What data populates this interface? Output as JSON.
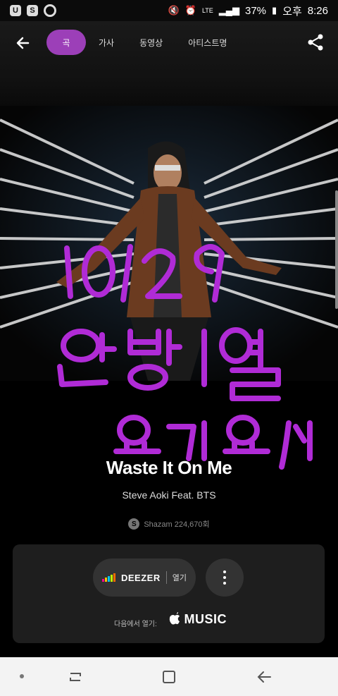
{
  "status_bar": {
    "battery": "37%",
    "network": "LTE",
    "ampm": "오후",
    "time": "8:26"
  },
  "app_bar": {
    "tabs": [
      {
        "label": "곡",
        "active": true
      },
      {
        "label": "가사",
        "active": false
      },
      {
        "label": "동영상",
        "active": false
      },
      {
        "label": "아티스트명",
        "active": false
      }
    ],
    "accent_color": "#9c3fb8"
  },
  "song": {
    "title": "Waste It On Me",
    "artist": "Steve Aoki Feat. BTS"
  },
  "shazam": {
    "count_text": "Shazam 224,670회"
  },
  "open_panel": {
    "deezer_label": "DEEZER",
    "deezer_action": "열기",
    "open_in_label": "다음에서 열기:",
    "apple_music_label": "MUSIC"
  },
  "doodle": {
    "lines": [
      "10/29",
      "안방이열",
      "요기요 ♡"
    ],
    "color": "#b02bd6"
  }
}
